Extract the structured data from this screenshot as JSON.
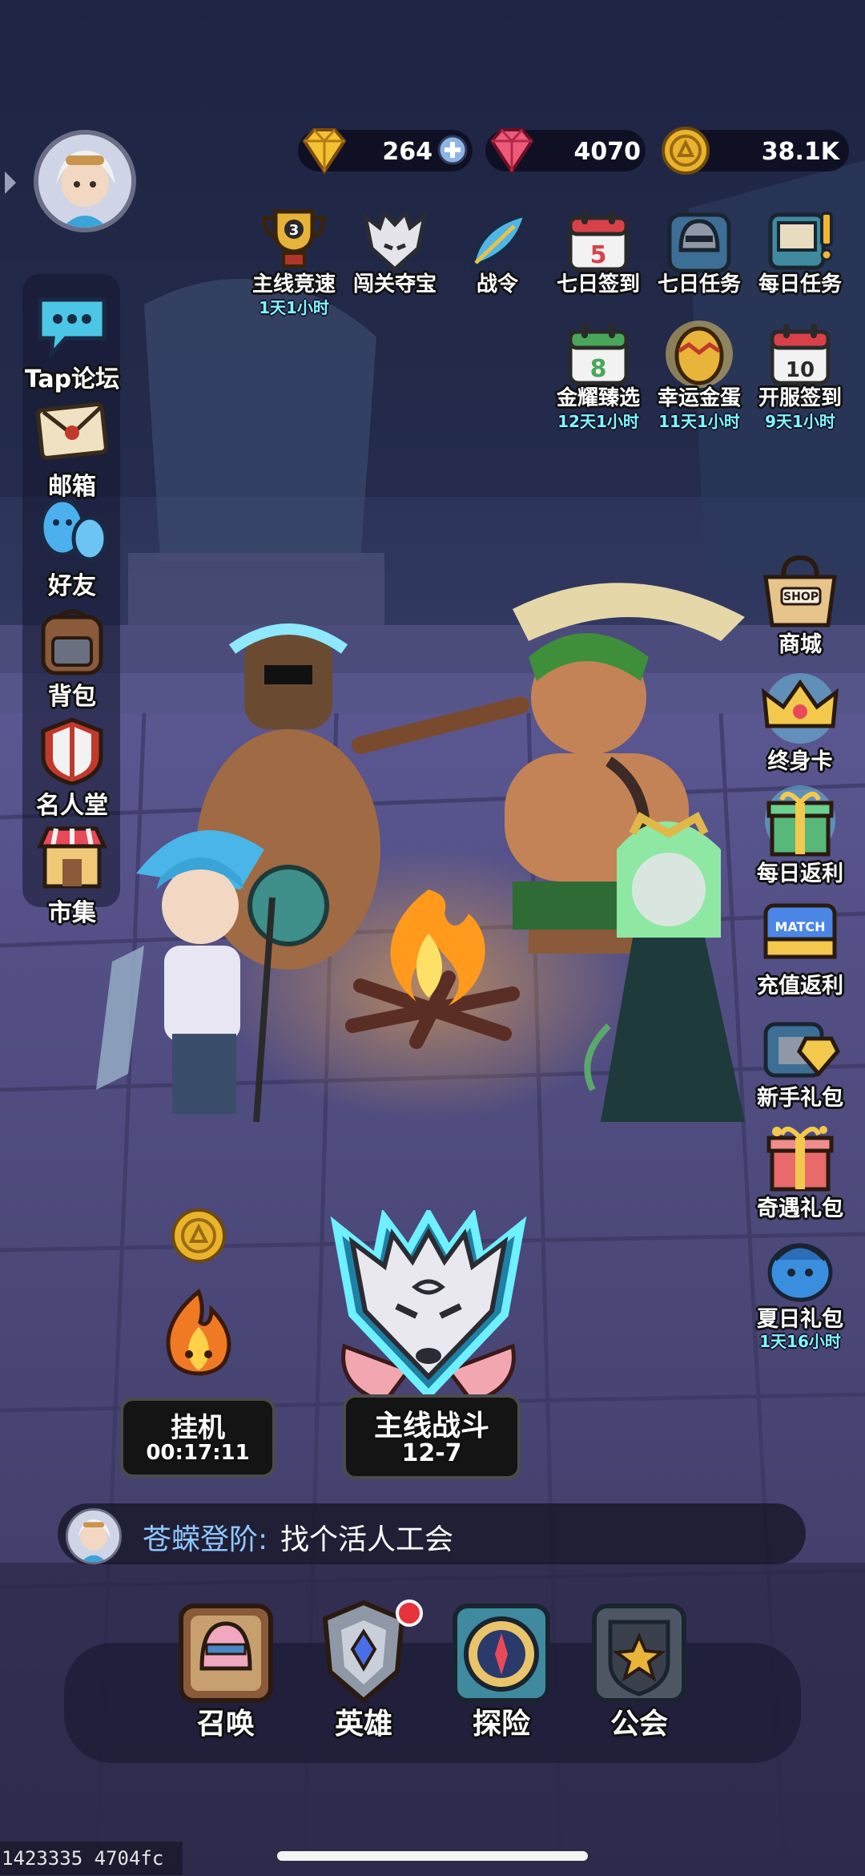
{
  "player": {
    "avatar_icon": "player-avatar-icon"
  },
  "resources": {
    "gems_gold": "264",
    "gems_red": "4070",
    "coins": "38.1K"
  },
  "top_menu": {
    "row1": [
      {
        "label": "主线竞速",
        "timer": "1天1小时",
        "icon": "trophy-icon"
      },
      {
        "label": "闯关夺宝",
        "timer": "",
        "icon": "wolf-mask-icon"
      },
      {
        "label": "战令",
        "timer": "",
        "icon": "feather-icon"
      },
      {
        "label": "七日签到",
        "timer": "",
        "icon": "calendar-icon",
        "badge": "5"
      },
      {
        "label": "七日任务",
        "timer": "",
        "icon": "helmet-icon"
      },
      {
        "label": "每日任务",
        "timer": "",
        "icon": "quest-board-icon"
      }
    ],
    "row2": [
      {
        "label": "金耀臻选",
        "timer": "12天1小时",
        "icon": "calendar-icon",
        "badge": "8"
      },
      {
        "label": "幸运金蛋",
        "timer": "11天1小时",
        "icon": "golden-egg-icon"
      },
      {
        "label": "开服签到",
        "timer": "9天1小时",
        "icon": "calendar-icon",
        "badge": "10"
      }
    ]
  },
  "left_menu": [
    {
      "label": "Tap论坛",
      "icon": "chat-bubble-icon"
    },
    {
      "label": "邮箱",
      "icon": "envelope-icon"
    },
    {
      "label": "好友",
      "icon": "friends-icon"
    },
    {
      "label": "背包",
      "icon": "backpack-icon"
    },
    {
      "label": "名人堂",
      "icon": "hall-of-fame-icon"
    },
    {
      "label": "市集",
      "icon": "market-stall-icon"
    }
  ],
  "right_menu": [
    {
      "label": "商城",
      "timer": "",
      "icon": "shop-bag-icon",
      "tag": "SHOP"
    },
    {
      "label": "终身卡",
      "timer": "",
      "icon": "crown-icon"
    },
    {
      "label": "每日返利",
      "timer": "",
      "icon": "gift-box-icon"
    },
    {
      "label": "充值返利",
      "timer": "",
      "icon": "match-ticket-icon",
      "tag": "MATCH"
    },
    {
      "label": "新手礼包",
      "timer": "",
      "icon": "chest-icon"
    },
    {
      "label": "奇遇礼包",
      "timer": "",
      "icon": "gift-box-icon"
    },
    {
      "label": "夏日礼包",
      "timer": "1天16小时",
      "icon": "character-gift-icon"
    }
  ],
  "idle": {
    "label": "挂机",
    "time": "00:17:11"
  },
  "main_battle": {
    "label": "主线战斗",
    "stage": "12-7"
  },
  "chat": {
    "name": "苍蝾登阶:",
    "message": "找个活人工会"
  },
  "bottom_nav": [
    {
      "label": "召唤",
      "icon": "summon-helmet-icon"
    },
    {
      "label": "英雄",
      "icon": "hero-crest-icon",
      "notify": true
    },
    {
      "label": "探险",
      "icon": "compass-icon"
    },
    {
      "label": "公会",
      "icon": "guild-shield-icon"
    }
  ],
  "debug_text": "1423335 4704fc",
  "colors": {
    "timer": "#7ff5ff",
    "chat_name": "#8fc8ff",
    "notify_dot": "#e8333a"
  }
}
